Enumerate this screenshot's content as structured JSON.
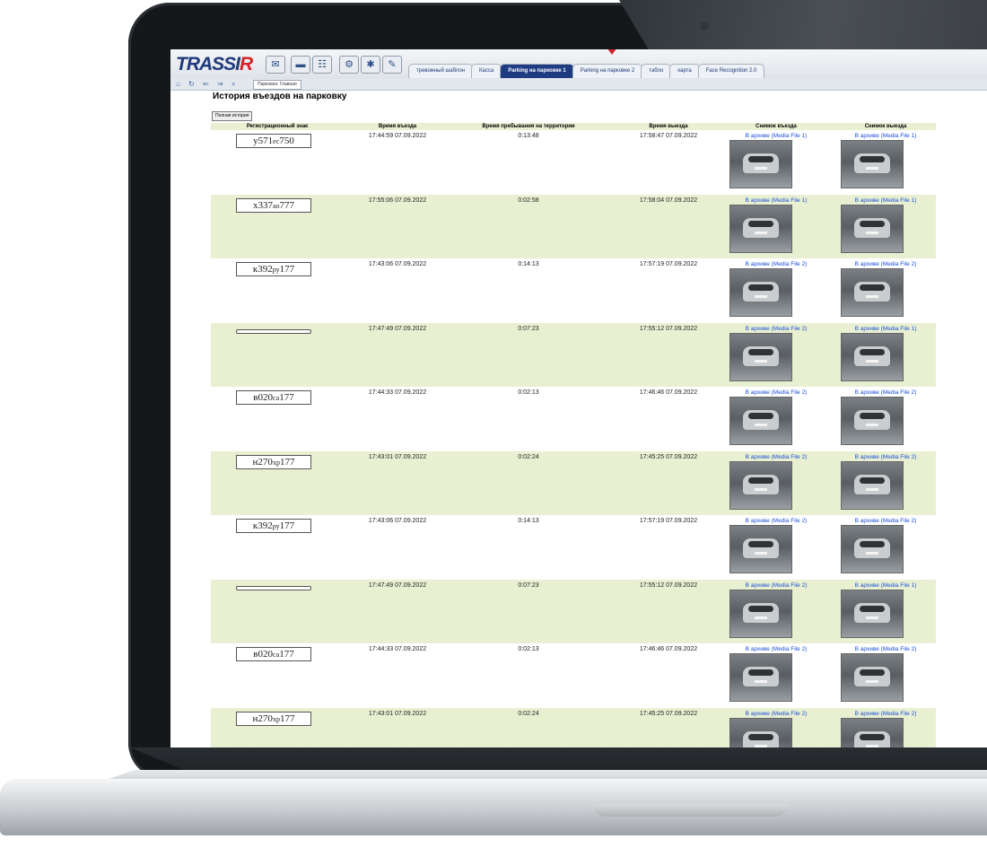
{
  "app": {
    "logo_main": "TRASSI",
    "logo_r": "R"
  },
  "toolbar": {
    "tabs": [
      "тревожный шаблон",
      "Касса",
      "Parking на парковке 1",
      "Parking на парковке 2",
      "табло",
      "карта",
      "Face Recognition 2.0"
    ],
    "active_tab": "Parking на парковке 1"
  },
  "nav": {
    "breadcrumb": "Парковка: Главная"
  },
  "page": {
    "title": "История въездов на парковку",
    "history_button": "Полная история"
  },
  "table": {
    "headers": [
      "Регистрационный знак",
      "Время въезда",
      "Время пребывания на территории",
      "Время выезда",
      "Снимок въезда",
      "Снимок выезда"
    ],
    "rows": [
      {
        "plate_a": "у571",
        "plate_b": "ес",
        "plate_c": "750",
        "entry": "17:44:59 07.09.2022",
        "stay": "0:13:48",
        "exit": "17:58:47 07.09.2022",
        "in_link": "В архиве (Media File 1)",
        "out_link": "В архиве (Media File 1)"
      },
      {
        "plate_a": "х337",
        "plate_b": "ао",
        "plate_c": "777",
        "entry": "17:55:06 07.09.2022",
        "stay": "0:02:58",
        "exit": "17:58:04 07.09.2022",
        "in_link": "В архиве (Media File 1)",
        "out_link": "В архиве (Media File 1)"
      },
      {
        "plate_a": "к392",
        "plate_b": "ру",
        "plate_c": "177",
        "entry": "17:43:06 07.09.2022",
        "stay": "0:14:13",
        "exit": "17:57:19 07.09.2022",
        "in_link": "В архиве (Media File 2)",
        "out_link": "В архиве (Media File 2)"
      },
      {
        "plate_a": "",
        "plate_b": "",
        "plate_c": "",
        "entry": "17:47:49 07.09.2022",
        "stay": "0:07:23",
        "exit": "17:55:12 07.09.2022",
        "in_link": "В архиве (Media File 2)",
        "out_link": "В архиве (Media File 1)"
      },
      {
        "plate_a": "в020",
        "plate_b": "са",
        "plate_c": "177",
        "entry": "17:44:33 07.09.2022",
        "stay": "0:02:13",
        "exit": "17:46:46 07.09.2022",
        "in_link": "В архиве (Media File 2)",
        "out_link": "В архиве (Media File 2)"
      },
      {
        "plate_a": "н270",
        "plate_b": "хр",
        "plate_c": "177",
        "entry": "17:43:01 07.09.2022",
        "stay": "0:02:24",
        "exit": "17:45:25 07.09.2022",
        "in_link": "В архиве (Media File 2)",
        "out_link": "В архиве (Media File 2)"
      },
      {
        "plate_a": "к392",
        "plate_b": "ру",
        "plate_c": "177",
        "entry": "17:43:06 07.09.2022",
        "stay": "0:14:13",
        "exit": "17:57:19 07.09.2022",
        "in_link": "В архиве (Media File 2)",
        "out_link": "В архиве (Media File 2)"
      },
      {
        "plate_a": "",
        "plate_b": "",
        "plate_c": "",
        "entry": "17:47:49 07.09.2022",
        "stay": "0:07:23",
        "exit": "17:55:12 07.09.2022",
        "in_link": "В архиве (Media File 2)",
        "out_link": "В архиве (Media File 1)"
      },
      {
        "plate_a": "в020",
        "plate_b": "са",
        "plate_c": "177",
        "entry": "17:44:33 07.09.2022",
        "stay": "0:02:13",
        "exit": "17:46:46 07.09.2022",
        "in_link": "В архиве (Media File 2)",
        "out_link": "В архиве (Media File 2)"
      },
      {
        "plate_a": "н270",
        "plate_b": "хр",
        "plate_c": "177",
        "entry": "17:43:01 07.09.2022",
        "stay": "0:02:24",
        "exit": "17:45:25 07.09.2022",
        "in_link": "В архиве (Media File 2)",
        "out_link": "В архиве (Media File 2)"
      }
    ]
  },
  "icons": {
    "home": "home-icon",
    "refresh": "refresh-icon",
    "back": "back-icon",
    "forward": "forward-icon",
    "search": "search-icon"
  },
  "colors": {
    "brand": "#1e3a7a",
    "accent": "#d2232a",
    "row_alt": "#e9f0d2",
    "link": "#1a4fd6"
  }
}
